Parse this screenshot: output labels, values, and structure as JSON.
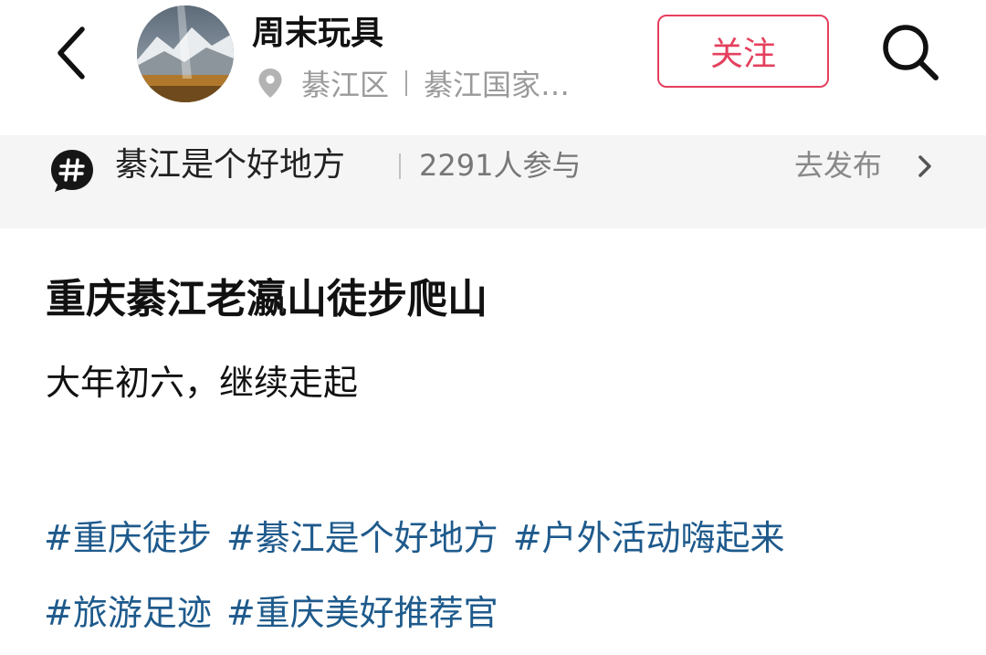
{
  "header": {
    "author_name": "周末玩具",
    "location_district": "綦江区",
    "location_place": "綦江国家…",
    "follow_label": "关注",
    "accent_color": "#e5405e"
  },
  "topic_bar": {
    "topic_name": "綦江是个好地方",
    "participants": "2291人参与",
    "publish_label": "去发布"
  },
  "post": {
    "title": "重庆綦江老瀛山徒步爬山",
    "body": "大年初六，继续走起",
    "tags": [
      "#重庆徒步",
      "#綦江是个好地方",
      "#户外活动嗨起来",
      "#旅游足迹",
      "#重庆美好推荐官"
    ],
    "tag_color": "#1e5a8c"
  },
  "icons": {
    "back": "chevron-left-icon",
    "search": "search-icon",
    "location": "location-pin-icon",
    "topic": "hashtag-bubble-icon",
    "publish_arrow": "chevron-right-icon"
  }
}
